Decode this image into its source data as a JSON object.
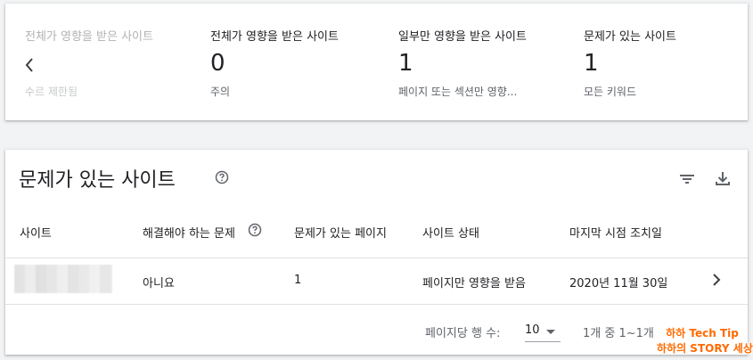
{
  "summary": {
    "stats": [
      {
        "label": "전체가 영향을 받은 사이트",
        "value": "",
        "sub": "수르 제한됨"
      },
      {
        "label": "전체가 영향을 받은 사이트",
        "value": "0",
        "sub": "주의"
      },
      {
        "label": "일부만 영향을 받은 사이트",
        "value": "1",
        "sub": "페이지 또는 섹션만 영향..."
      },
      {
        "label": "문제가 있는 사이트",
        "value": "1",
        "sub": "모든 키워드"
      }
    ],
    "carousel_prev_icon": "chevron-left-icon"
  },
  "table": {
    "title": "문제가 있는 사이트",
    "columns": [
      "사이트",
      "해결해야 하는 문제",
      "문제가 있는 페이지",
      "사이트 상태",
      "마지막 시점 조치일"
    ],
    "rows": [
      {
        "site": "",
        "issue": "아니요",
        "pages": "1",
        "status": "페이지만 영향을 받음",
        "date": "2020년 11월 30일"
      }
    ],
    "rows_per_page_label": "페이지당 행 수:",
    "rows_per_page_value": "10",
    "range_text": "1개 중 1~1개",
    "icons": {
      "title_help": "help-circle-icon",
      "filter": "filter-icon",
      "download": "download-icon",
      "row_open": "chevron-right-icon"
    }
  },
  "watermark": {
    "line1": "하하 Tech Tip",
    "line2": "하하의 STORY 세상"
  }
}
